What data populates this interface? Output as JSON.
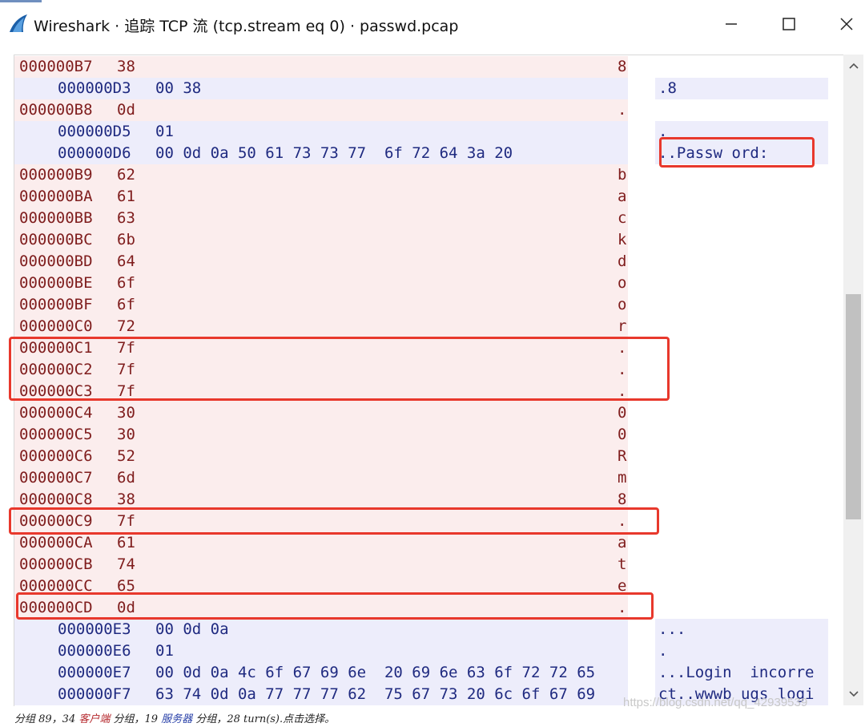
{
  "window": {
    "title": "Wireshark · 追踪 TCP 流 (tcp.stream eq 0) · passwd.pcap",
    "icon": "wireshark-fin-icon",
    "controls": {
      "minimize": "minimize-icon",
      "maximize": "maximize-icon",
      "close": "close-icon"
    }
  },
  "colors": {
    "client_bg": "#fbeded",
    "client_text": "#7f1d1d",
    "server_bg": "#ededfb",
    "server_text": "#1f2a80",
    "highlight": "#e8382c"
  },
  "rows": [
    {
      "dir": "client",
      "offset": "000000B7",
      "hex": "38",
      "ascii": "8"
    },
    {
      "dir": "server",
      "offset": "000000D3",
      "hex": "00 38",
      "ascii": ".8"
    },
    {
      "dir": "client",
      "offset": "000000B8",
      "hex": "0d",
      "ascii": "."
    },
    {
      "dir": "server",
      "offset": "000000D5",
      "hex": "01",
      "ascii": "."
    },
    {
      "dir": "server",
      "offset": "000000D6",
      "hex": "00 0d 0a 50 61 73 73 77  6f 72 64 3a 20",
      "ascii": "..Passw ord: "
    },
    {
      "dir": "client",
      "offset": "000000B9",
      "hex": "62",
      "ascii": "b"
    },
    {
      "dir": "client",
      "offset": "000000BA",
      "hex": "61",
      "ascii": "a"
    },
    {
      "dir": "client",
      "offset": "000000BB",
      "hex": "63",
      "ascii": "c"
    },
    {
      "dir": "client",
      "offset": "000000BC",
      "hex": "6b",
      "ascii": "k"
    },
    {
      "dir": "client",
      "offset": "000000BD",
      "hex": "64",
      "ascii": "d"
    },
    {
      "dir": "client",
      "offset": "000000BE",
      "hex": "6f",
      "ascii": "o"
    },
    {
      "dir": "client",
      "offset": "000000BF",
      "hex": "6f",
      "ascii": "o"
    },
    {
      "dir": "client",
      "offset": "000000C0",
      "hex": "72",
      "ascii": "r"
    },
    {
      "dir": "client",
      "offset": "000000C1",
      "hex": "7f",
      "ascii": "."
    },
    {
      "dir": "client",
      "offset": "000000C2",
      "hex": "7f",
      "ascii": "."
    },
    {
      "dir": "client",
      "offset": "000000C3",
      "hex": "7f",
      "ascii": "."
    },
    {
      "dir": "client",
      "offset": "000000C4",
      "hex": "30",
      "ascii": "0"
    },
    {
      "dir": "client",
      "offset": "000000C5",
      "hex": "30",
      "ascii": "0"
    },
    {
      "dir": "client",
      "offset": "000000C6",
      "hex": "52",
      "ascii": "R"
    },
    {
      "dir": "client",
      "offset": "000000C7",
      "hex": "6d",
      "ascii": "m"
    },
    {
      "dir": "client",
      "offset": "000000C8",
      "hex": "38",
      "ascii": "8"
    },
    {
      "dir": "client",
      "offset": "000000C9",
      "hex": "7f",
      "ascii": "."
    },
    {
      "dir": "client",
      "offset": "000000CA",
      "hex": "61",
      "ascii": "a"
    },
    {
      "dir": "client",
      "offset": "000000CB",
      "hex": "74",
      "ascii": "t"
    },
    {
      "dir": "client",
      "offset": "000000CC",
      "hex": "65",
      "ascii": "e"
    },
    {
      "dir": "client",
      "offset": "000000CD",
      "hex": "0d",
      "ascii": "."
    },
    {
      "dir": "server",
      "offset": "000000E3",
      "hex": "00 0d 0a",
      "ascii": "..."
    },
    {
      "dir": "server",
      "offset": "000000E6",
      "hex": "01",
      "ascii": "."
    },
    {
      "dir": "server",
      "offset": "000000E7",
      "hex": "00 0d 0a 4c 6f 67 69 6e  20 69 6e 63 6f 72 72 65",
      "ascii": "...Login  incorre"
    },
    {
      "dir": "server",
      "offset": "000000F7",
      "hex": "63 74 0d 0a 77 77 77 62  75 67 73 20 6c 6f 67 69",
      "ascii": "ct..wwwb ugs logi"
    }
  ],
  "scrollbar": {
    "position": 0.57,
    "visible_fraction": 0.37
  },
  "status_bar": {
    "prefix": "分组 89，34 ",
    "client_label": "客户端",
    "mid1": " 分组，19 ",
    "server_label": "服务器",
    "suffix": " 分组，28 turn(s).点击选择。"
  },
  "watermark": "https://blog.csdn.net/qq_42939539"
}
